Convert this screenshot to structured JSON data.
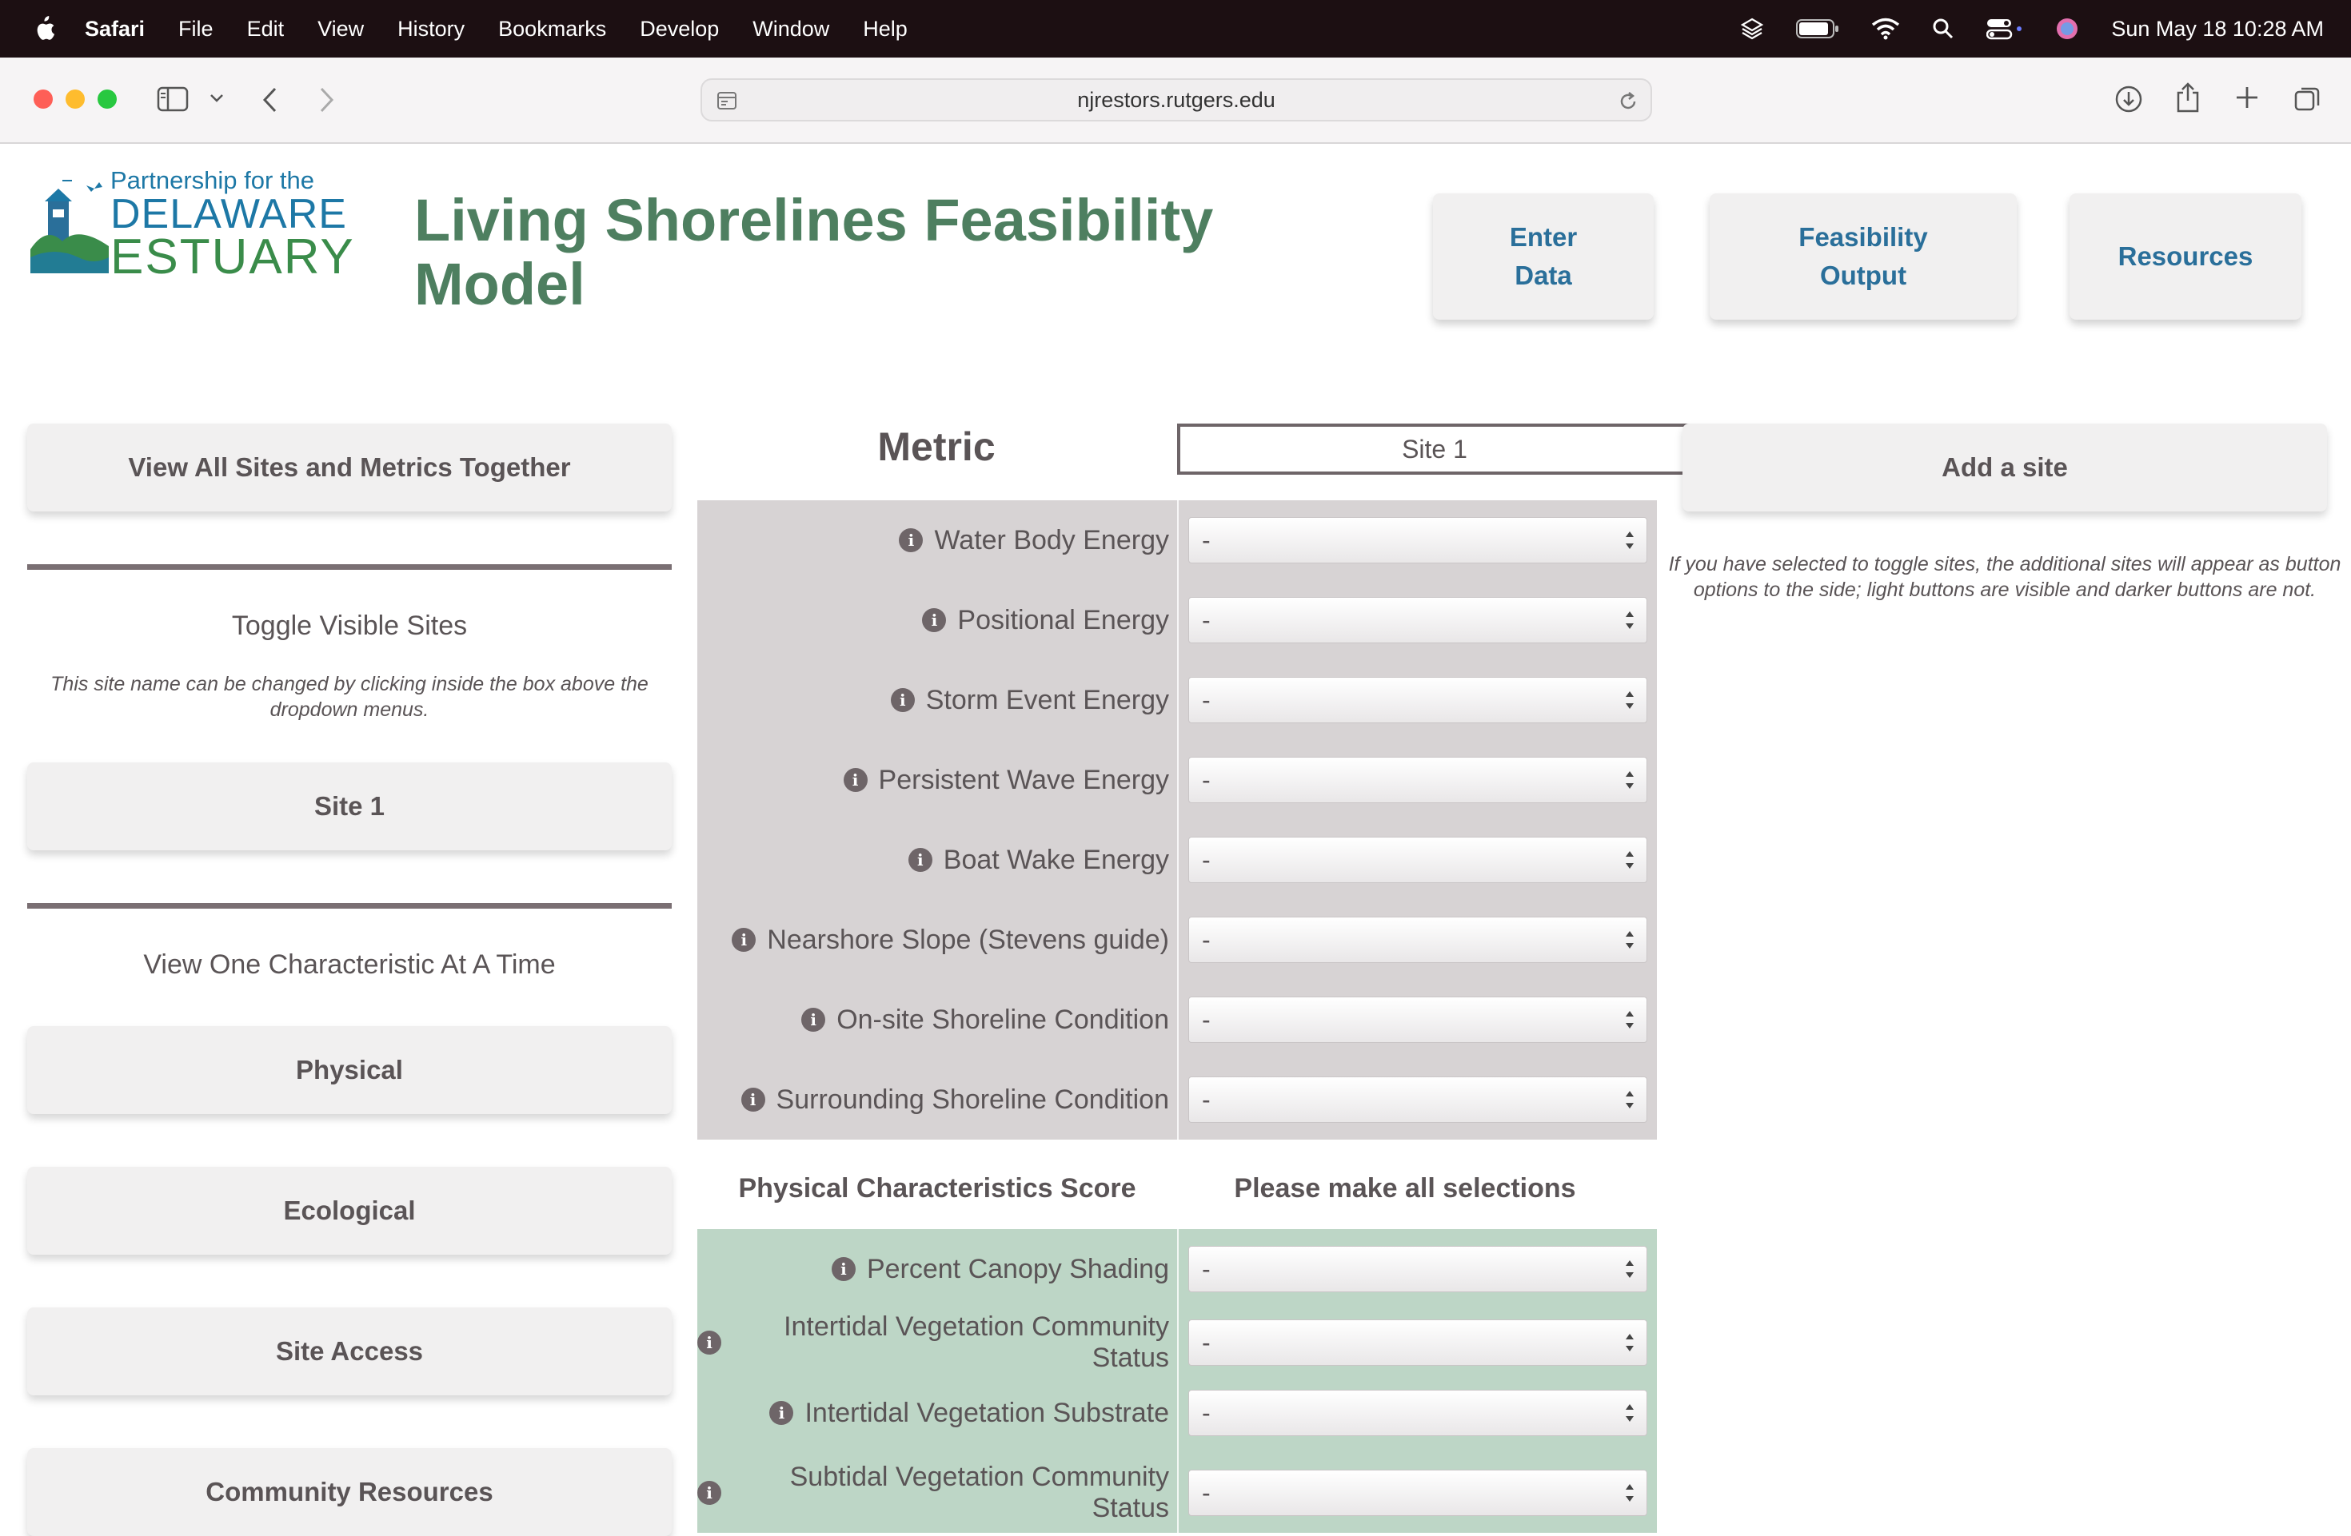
{
  "menubar": {
    "app": "Safari",
    "items": [
      "File",
      "Edit",
      "View",
      "History",
      "Bookmarks",
      "Develop",
      "Window",
      "Help"
    ],
    "clock": "Sun May 18  10:28 AM"
  },
  "browser": {
    "url": "njrestors.rutgers.edu"
  },
  "logo": {
    "line1": "Partnership for the",
    "line2": "DELAWARE",
    "line3": "ESTUARY"
  },
  "header": {
    "title": "Living Shorelines Feasibility Model",
    "nav": [
      "Enter Data",
      "Feasibility Output",
      "Resources"
    ]
  },
  "sidebar": {
    "view_all": "View All Sites and Metrics Together",
    "toggle_heading": "Toggle Visible Sites",
    "toggle_note": "This site name can be changed by clicking inside the box above the dropdown menus.",
    "site_button": "Site 1",
    "characteristic_heading": "View One Characteristic At A Time",
    "characteristics": [
      "Physical",
      "Ecological",
      "Site Access",
      "Community Resources"
    ]
  },
  "table": {
    "metric_header": "Metric",
    "site_name": "Site 1",
    "physical_metrics": [
      {
        "label": "Water Body Energy",
        "value": "-"
      },
      {
        "label": "Positional Energy",
        "value": "-"
      },
      {
        "label": "Storm Event Energy",
        "value": "-"
      },
      {
        "label": "Persistent Wave Energy",
        "value": "-"
      },
      {
        "label": "Boat Wake Energy",
        "value": "-"
      },
      {
        "label": "Nearshore Slope (Stevens guide)",
        "value": "-"
      },
      {
        "label": "On-site Shoreline Condition",
        "value": "-"
      },
      {
        "label": "Surrounding Shoreline Condition",
        "value": "-"
      }
    ],
    "physical_score_label": "Physical Characteristics Score",
    "physical_score_value": "Please make all selections",
    "ecological_metrics": [
      {
        "label": "Percent Canopy Shading",
        "value": "-"
      },
      {
        "label": "Intertidal Vegetation Community Status",
        "value": "-"
      },
      {
        "label": "Intertidal Vegetation Substrate",
        "value": "-"
      },
      {
        "label": "Subtidal Vegetation Community Status",
        "value": "-"
      }
    ]
  },
  "right": {
    "add_site": "Add a site",
    "note": "If you have selected to toggle sites, the additional sites will appear as button options to the side; light buttons are visible and darker buttons are not."
  },
  "colors": {
    "title_green": "#4e7f60",
    "nav_blue": "#2a6f9a",
    "physical_panel": "#d7d3d4",
    "ecological_panel": "#bdd6c6",
    "text_gray": "#5a5456"
  }
}
